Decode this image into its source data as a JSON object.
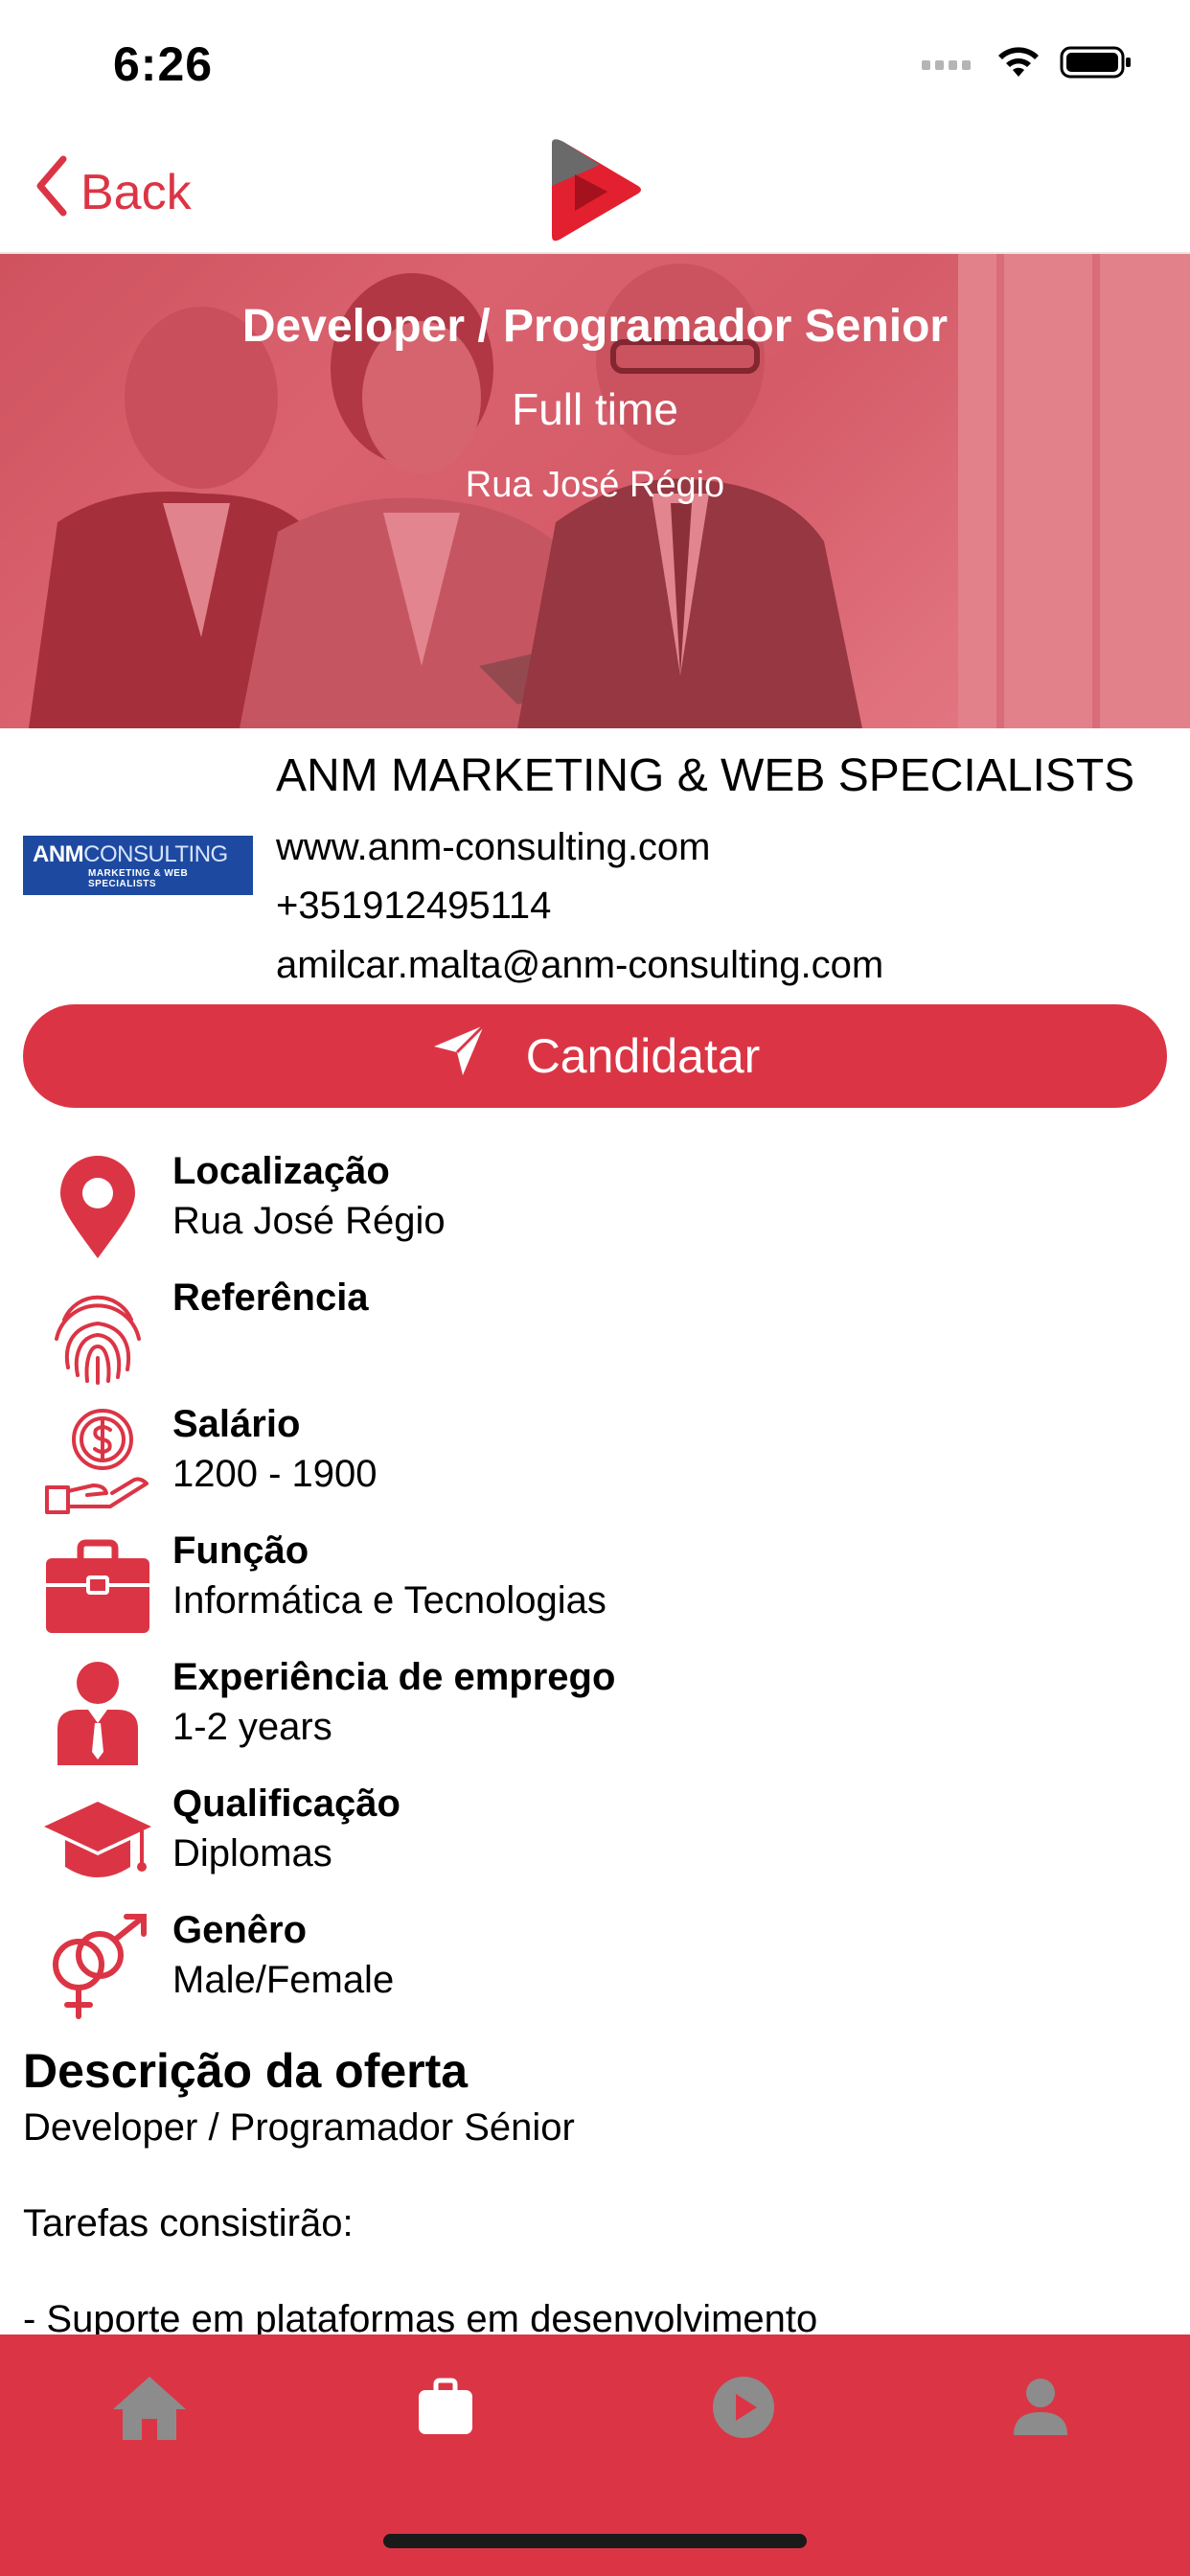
{
  "status_bar": {
    "time": "6:26"
  },
  "nav": {
    "back_label": "Back",
    "logo_icon": "play-logo-icon"
  },
  "hero": {
    "title": "Developer / Programador Senior",
    "subtitle": "Full time",
    "location": "Rua José Régio"
  },
  "company": {
    "logo_text_bold": "ANM",
    "logo_text_light": "CONSULTING",
    "logo_tagline": "MARKETING & WEB SPECIALISTS",
    "name": "ANM MARKETING & WEB SPECIALISTS",
    "website": "www.anm-consulting.com",
    "phone": "+351912495114",
    "email": "amilcar.malta@anm-consulting.com"
  },
  "apply_button": {
    "label": "Candidatar",
    "icon": "send-icon"
  },
  "details": [
    {
      "icon": "location-pin-icon",
      "label": "Localização",
      "value": "Rua José Régio"
    },
    {
      "icon": "fingerprint-icon",
      "label": "Referência",
      "value": ""
    },
    {
      "icon": "salary-hand-icon",
      "label": "Salário",
      "value": "1200 - 1900"
    },
    {
      "icon": "briefcase-icon",
      "label": "Função",
      "value": "Informática e Tecnologias"
    },
    {
      "icon": "employee-icon",
      "label": "Experiência de emprego",
      "value": "1-2 years"
    },
    {
      "icon": "graduation-cap-icon",
      "label": "Qualificação",
      "value": "Diplomas"
    },
    {
      "icon": "gender-icon",
      "label": "Genêro",
      "value": "Male/Female"
    }
  ],
  "description": {
    "title": "Descrição da oferta",
    "lines": [
      "Developer / Programador Sénior",
      "",
      "Tarefas consistirão:",
      "",
      "- Suporte em plataformas em desenvolvimento"
    ]
  },
  "tab_bar": {
    "tabs": [
      {
        "icon": "home-icon",
        "active": false
      },
      {
        "icon": "jobs-briefcase-icon",
        "active": true
      },
      {
        "icon": "play-circle-icon",
        "active": false
      },
      {
        "icon": "profile-icon",
        "active": false
      }
    ]
  },
  "colors": {
    "accent": "#db3545",
    "tab_inactive": "#8c8c8c",
    "tab_active": "#ffffff"
  }
}
